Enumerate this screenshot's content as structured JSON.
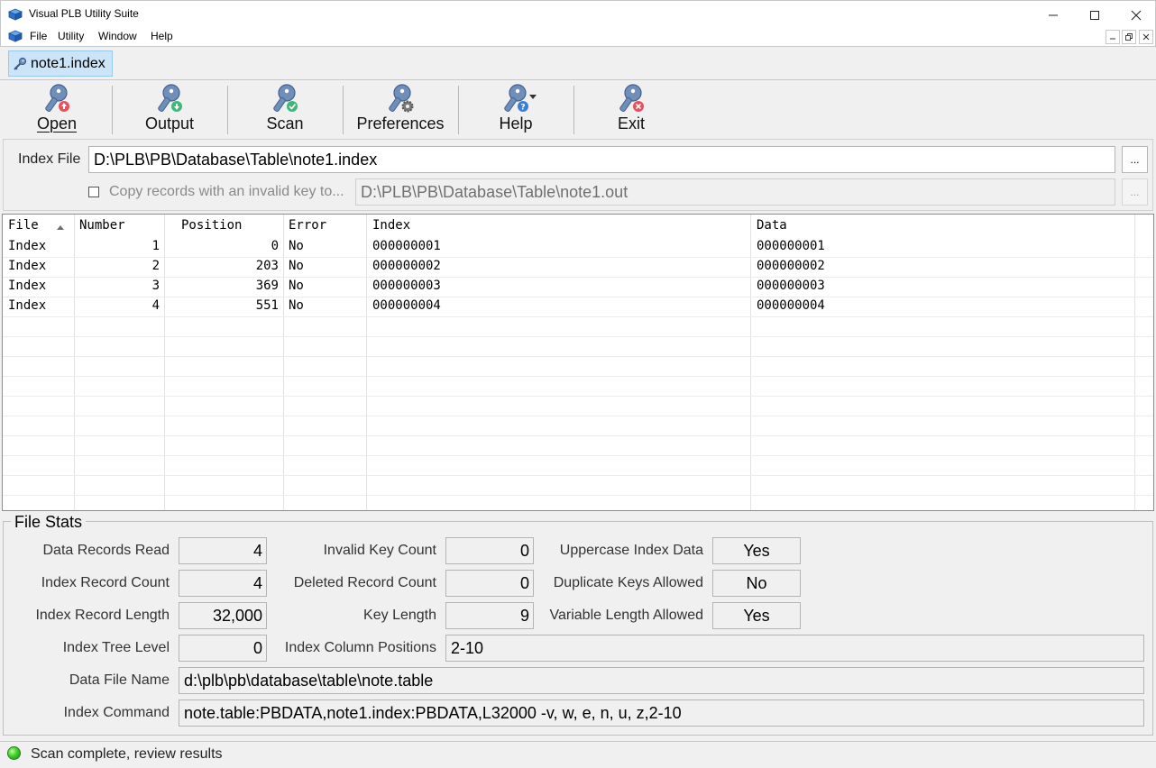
{
  "window": {
    "title": "Visual PLB Utility Suite",
    "icons": {
      "app": "app-cube-icon",
      "minimize": "minimize-icon",
      "maximize": "maximize-icon",
      "close": "close-icon"
    }
  },
  "menu": {
    "items": [
      "File",
      "Utility",
      "Window",
      "Help"
    ]
  },
  "tab": {
    "label": "note1.index",
    "icon": "key-icon"
  },
  "toolbar": {
    "buttons": [
      {
        "label": "Open",
        "icon": "key-open-icon",
        "accent": "#e8505b"
      },
      {
        "label": "Output",
        "icon": "key-output-icon",
        "accent": "#3cb878"
      },
      {
        "label": "Scan",
        "icon": "key-scan-icon",
        "accent": "#3cb878"
      },
      {
        "label": "Preferences",
        "icon": "key-preferences-icon",
        "accent": "#7a7a7a"
      },
      {
        "label": "Help",
        "icon": "key-help-icon",
        "accent": "#3b7fd4"
      },
      {
        "label": "Exit",
        "icon": "key-exit-icon",
        "accent": "#e8505b"
      }
    ]
  },
  "file_panel": {
    "index_label": "Index File",
    "index_value": "D:\\PLB\\PB\\Database\\Table\\note1.index",
    "browse_label": "...",
    "copy_checked": false,
    "copy_label": "Copy records with an invalid key to...",
    "copy_value": "D:\\PLB\\PB\\Database\\Table\\note1.out",
    "copy_browse_label": "..."
  },
  "grid": {
    "columns": [
      "File",
      "Number",
      "Position",
      "Error",
      "Index",
      "Data"
    ],
    "sort_column": "File",
    "rows": [
      [
        "Index",
        "1",
        "0",
        "No",
        "000000001",
        "000000001"
      ],
      [
        "Index",
        "2",
        "203",
        "No",
        "000000002",
        "000000002"
      ],
      [
        "Index",
        "3",
        "369",
        "No",
        "000000003",
        "000000003"
      ],
      [
        "Index",
        "4",
        "551",
        "No",
        "000000004",
        "000000004"
      ]
    ]
  },
  "stats": {
    "title": "File Stats",
    "data_records_read": {
      "label": "Data Records Read",
      "value": "4"
    },
    "index_record_count": {
      "label": "Index Record Count",
      "value": "4"
    },
    "index_record_length": {
      "label": "Index Record Length",
      "value": "32,000"
    },
    "index_tree_level": {
      "label": "Index Tree Level",
      "value": "0"
    },
    "invalid_key_count": {
      "label": "Invalid Key Count",
      "value": "0"
    },
    "deleted_record_count": {
      "label": "Deleted Record Count",
      "value": "0"
    },
    "key_length": {
      "label": "Key Length",
      "value": "9"
    },
    "index_column_positions": {
      "label": "Index Column Positions",
      "value": "2-10"
    },
    "uppercase_index_data": {
      "label": "Uppercase Index Data",
      "value": "Yes"
    },
    "duplicate_keys_allowed": {
      "label": "Duplicate Keys Allowed",
      "value": "No"
    },
    "variable_length_allowed": {
      "label": "Variable Length Allowed",
      "value": "Yes"
    },
    "data_file_name": {
      "label": "Data File Name",
      "value": "d:\\plb\\pb\\database\\table\\note.table"
    },
    "index_command": {
      "label": "Index Command",
      "value": "note.table:PBDATA,note1.index:PBDATA,L32000 -v, w, e, n, u, z,2-10"
    }
  },
  "status": {
    "text": "Scan complete, review results",
    "indicator": "green-led-icon",
    "color": "#3fcf2a"
  }
}
